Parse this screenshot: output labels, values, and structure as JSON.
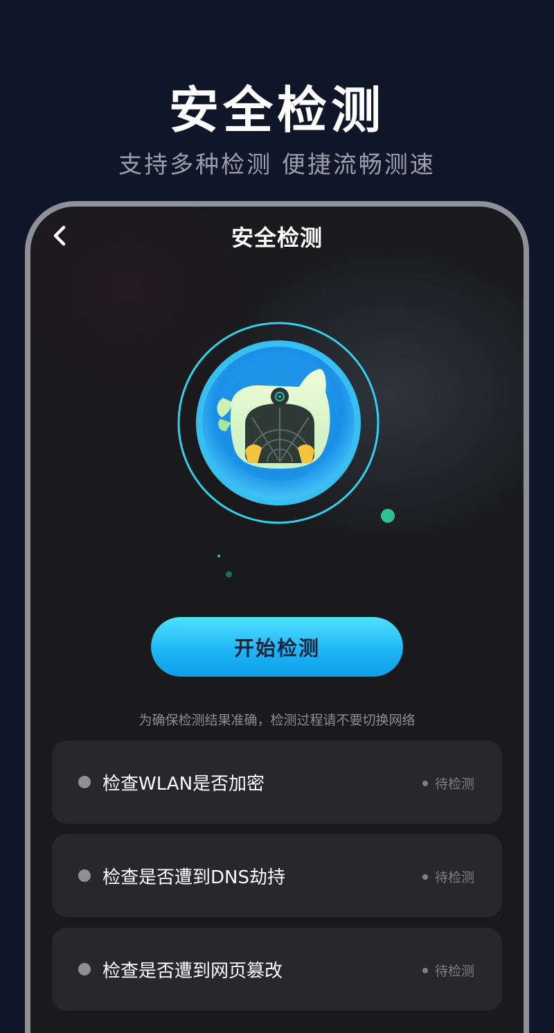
{
  "promo": {
    "title": "安全检测",
    "subtitle": "支持多种检测  便捷流畅测速"
  },
  "screen": {
    "title": "安全检测",
    "back_icon": "chevron-left-icon",
    "graphic_icon": "radar-scan-icon",
    "start_button_label": "开始检测",
    "hint": "为确保检测结果准确，检测过程请不要切换网络",
    "checks": [
      {
        "label": "检查WLAN是否加密",
        "status": "待检测"
      },
      {
        "label": "检查是否遭到DNS劫持",
        "status": "待检测"
      },
      {
        "label": "检查是否遭到网页篡改",
        "status": "待检测"
      }
    ]
  },
  "colors": {
    "page_background": "#0f1628",
    "screen_background": "#1a1a1c",
    "accent": "#1fb6f5",
    "card_background": "#28282b",
    "ring": "#2ed3ee",
    "decor_dot": "#2ec08f"
  }
}
